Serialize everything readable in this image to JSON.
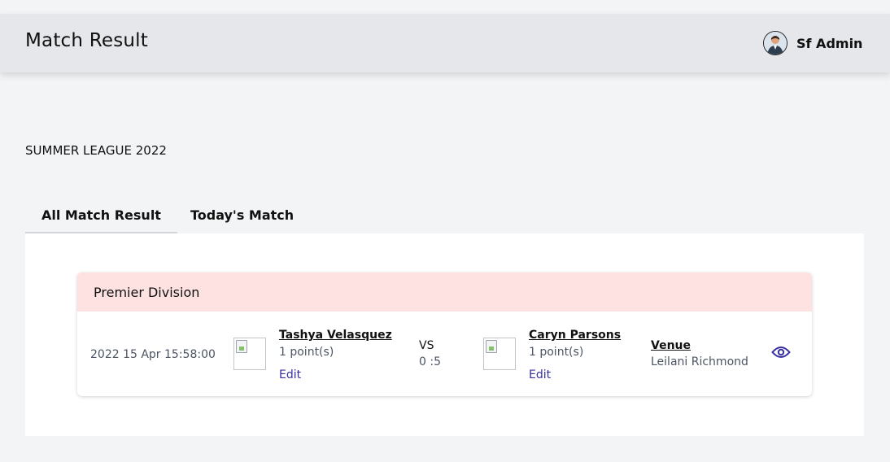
{
  "header": {
    "title": "Match Result",
    "user_name": "Sf Admin"
  },
  "league": "SUMMER LEAGUE 2022",
  "tabs": [
    {
      "label": "All Match Result",
      "active": true
    },
    {
      "label": "Today's Match",
      "active": false
    }
  ],
  "division": {
    "name": "Premier Division",
    "matches": [
      {
        "datetime": "2022 15 Apr 15:58:00",
        "home": {
          "name": "Tashya Velasquez",
          "points": "1 point(s)",
          "edit_label": "Edit"
        },
        "vs": "VS",
        "score": "0 :5",
        "away": {
          "name": "Caryn Parsons",
          "points": "1 point(s)",
          "edit_label": "Edit"
        },
        "venue_label": "Venue",
        "venue": "Leilani Richmond"
      }
    ]
  },
  "colors": {
    "background": "#f3f4f6",
    "header": "#e5e7eb",
    "division_header": "#fee2e2",
    "accent": "#3730a3"
  },
  "icons": {
    "view": "eye-icon",
    "avatar": "user-avatar",
    "team_image": "broken-image-icon"
  }
}
